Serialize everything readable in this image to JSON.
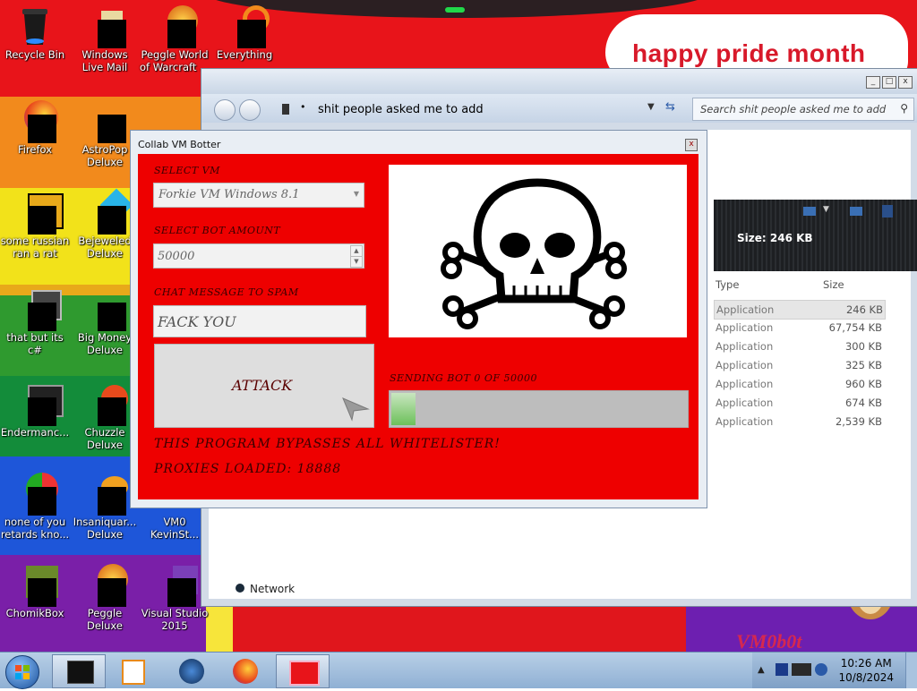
{
  "desktop": {
    "banner_text": "happy pride month",
    "watermark": "VM0b0t",
    "icons": [
      {
        "label": "Recycle Bin"
      },
      {
        "label": "Windows Live Mail"
      },
      {
        "label": "Peggle World of Warcraft ..."
      },
      {
        "label": "Everything"
      },
      {
        "label": "Firefox"
      },
      {
        "label": "AstroPop Deluxe"
      },
      {
        "label": "some russian ran a rat"
      },
      {
        "label": "Bejeweled Deluxe"
      },
      {
        "label": "that but its c#"
      },
      {
        "label": "Big Money Deluxe"
      },
      {
        "label": "Endermanc..."
      },
      {
        "label": "Chuzzle Deluxe"
      },
      {
        "label": "none of you retards kno..."
      },
      {
        "label": "Insaniquar... Deluxe"
      },
      {
        "label": "VM0 KevinSt..."
      },
      {
        "label": "ChomikBox"
      },
      {
        "label": "Peggle Deluxe"
      },
      {
        "label": "Visual Studio 2015"
      }
    ]
  },
  "explorer": {
    "address": "shit people asked me to add",
    "search_placeholder": "Search shit people asked me to add",
    "size_label": "Size:",
    "size_value": "246 KB",
    "columns": [
      "Type",
      "Size"
    ],
    "files": [
      {
        "type": "Application",
        "size": "246 KB"
      },
      {
        "type": "Application",
        "size": "67,754 KB"
      },
      {
        "type": "Application",
        "size": "300 KB"
      },
      {
        "type": "Application",
        "size": "325 KB"
      },
      {
        "type": "Application",
        "size": "960 KB"
      },
      {
        "type": "Application",
        "size": "674 KB"
      },
      {
        "type": "Application",
        "size": "2,539 KB"
      }
    ],
    "nav_network": "Network"
  },
  "dialog": {
    "title": "Collab VM Botter",
    "select_vm_label": "SELECT VM",
    "select_vm_value": "Forkie VM Windows 8.1",
    "bot_amount_label": "SELECT BOT AMOUNT",
    "bot_amount_value": "50000",
    "chat_label": "CHAT MESSAGE TO SPAM",
    "chat_value": "FACK YOU",
    "attack_label": "ATTACK",
    "progress_label": "SENDING BOT 0 OF 50000",
    "progress_fraction": 0.08,
    "bypass_text": "THIS PROGRAM BYPASSES ALL WHITELISTER!",
    "proxies_text": "PROXIES LOADED: 18888"
  },
  "taskbar": {
    "time": "10:26 AM",
    "date": "10/8/2024"
  },
  "colors": {
    "dialog_bg": "#ee0000",
    "dialog_text": "#3a0000",
    "banner_text": "#d8192a"
  }
}
